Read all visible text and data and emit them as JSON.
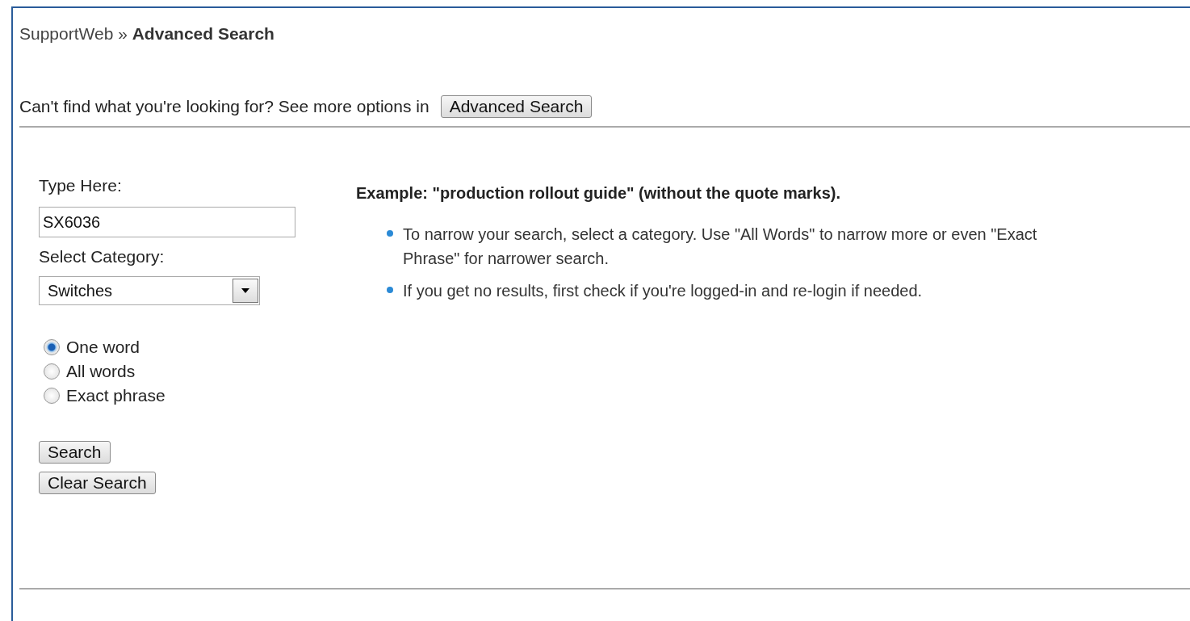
{
  "breadcrumb": "SupportWeb » **Advanced Search**",
  "prompt": {
    "text": "Can't find what you're looking for? See more options in",
    "button": "Advanced Search"
  },
  "form": {
    "query_label": "Type Here:",
    "query_value": "SX6036",
    "category_label": "Select Category:",
    "category_value": "Switches",
    "match_options": [
      {
        "label": "One word",
        "selected": true
      },
      {
        "label": "All words",
        "selected": false
      },
      {
        "label": "Exact phrase",
        "selected": false
      }
    ],
    "buttons": [
      "Search",
      "Clear Search"
    ]
  },
  "help": {
    "example": "Example: \"production rollout guide\" (without the quote marks).",
    "tips": [
      "To narrow your search, select a category. Use \"All Words\" to narrow more or even \"Exact Phrase\" for narrower search.",
      "If you get no results, first check if you're logged-in and re-login if needed."
    ]
  }
}
